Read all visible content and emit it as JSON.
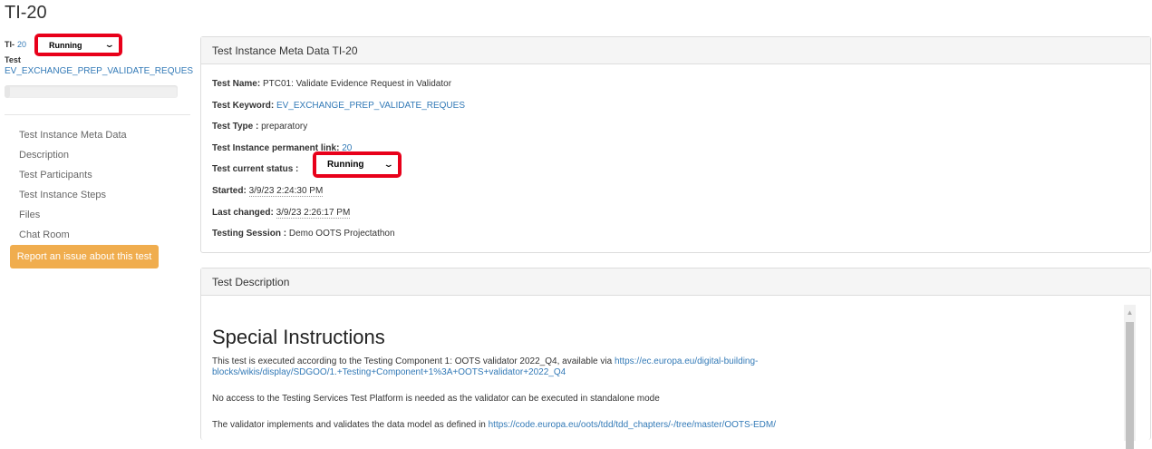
{
  "page": {
    "title": "TI-20"
  },
  "sidebar": {
    "ti_prefix": "TI-",
    "ti_number": "20",
    "status_select": {
      "value": "Running"
    },
    "test_label": "Test",
    "test_keyword": "EV_EXCHANGE_PREP_VALIDATE_REQUES",
    "progress_fraction": 0.03,
    "nav_items": [
      {
        "label": "Test Instance Meta Data"
      },
      {
        "label": "Description"
      },
      {
        "label": "Test Participants"
      },
      {
        "label": "Test Instance Steps"
      },
      {
        "label": "Files"
      },
      {
        "label": "Chat Room"
      }
    ],
    "report_button": "Report an issue about this test"
  },
  "meta_panel": {
    "heading": "Test Instance Meta Data TI-20",
    "test_name_label": "Test Name:",
    "test_name": "PTC01: Validate Evidence Request in Validator",
    "test_keyword_label": "Test Keyword:",
    "test_keyword": "EV_EXCHANGE_PREP_VALIDATE_REQUES",
    "test_type_label": "Test Type :",
    "test_type": "preparatory",
    "permalink_label": "Test Instance permanent link:",
    "permalink": "20",
    "status_label": "Test current status :",
    "status_value": "Running",
    "started_label": "Started:",
    "started": "3/9/23 2:24:30 PM",
    "last_changed_label": "Last changed:",
    "last_changed": "3/9/23 2:26:17 PM",
    "session_label": "Testing Session :",
    "session": "Demo OOTS Projectathon"
  },
  "description_panel": {
    "heading": "Test Description",
    "section_title": "Special Instructions",
    "para1_text": "This test is executed according to the Testing Component 1: OOTS validator 2022_Q4, available via ",
    "para1_link_a": "https://ec.europa.eu/digital-building-",
    "para1_link_b": "blocks/wikis/display/SDGOO/1.+Testing+Component+1%3A+OOTS+validator+2022_Q4",
    "para2_text": "No access to the Testing Services Test Platform is needed as the validator can be executed in standalone mode",
    "para3_text": "The validator implements and validates the data model as defined in ",
    "para3_link": "https://code.europa.eu/oots/tdd/tdd_chapters/-/tree/master/OOTS-EDM/"
  },
  "colors": {
    "link": "#337ab7",
    "warning_button": "#f0ad4e",
    "highlight": "#e8001a"
  }
}
